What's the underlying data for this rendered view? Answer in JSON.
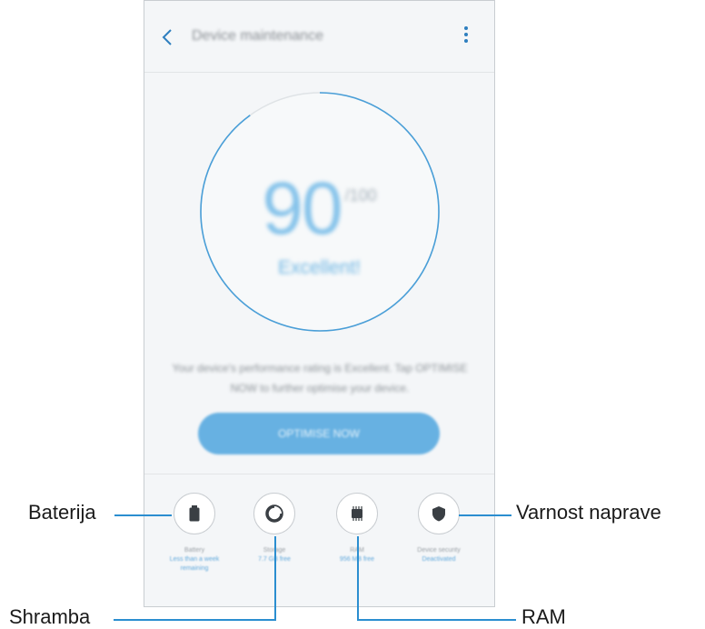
{
  "app": {
    "title": "Device maintenance",
    "back_icon": "chevron-left-icon",
    "more_icon": "more-vertical-icon"
  },
  "score": {
    "value": "90",
    "max": "/100",
    "status": "Excellent!",
    "progress_fraction": 0.9
  },
  "description": "Your device's performance rating is Excellent. Tap OPTIMISE NOW to further optimise your device.",
  "optimize_button": "OPTIMISE NOW",
  "tiles": [
    {
      "name": "Battery",
      "value": "Less than a week remaining",
      "icon": "battery-icon"
    },
    {
      "name": "Storage",
      "value": "7.7 GB free",
      "icon": "storage-icon"
    },
    {
      "name": "RAM",
      "value": "956 MB free",
      "icon": "memory-chip-icon"
    },
    {
      "name": "Device security",
      "value": "Deactivated",
      "icon": "shield-icon"
    }
  ],
  "callouts": {
    "battery": "Baterija",
    "storage": "Shramba",
    "ram": "RAM",
    "security": "Varnost naprave"
  },
  "colors": {
    "accent": "#2b8ed0",
    "ring": "#4a9fd8",
    "button": "#67b1e2",
    "background": "#f4f6f8"
  }
}
